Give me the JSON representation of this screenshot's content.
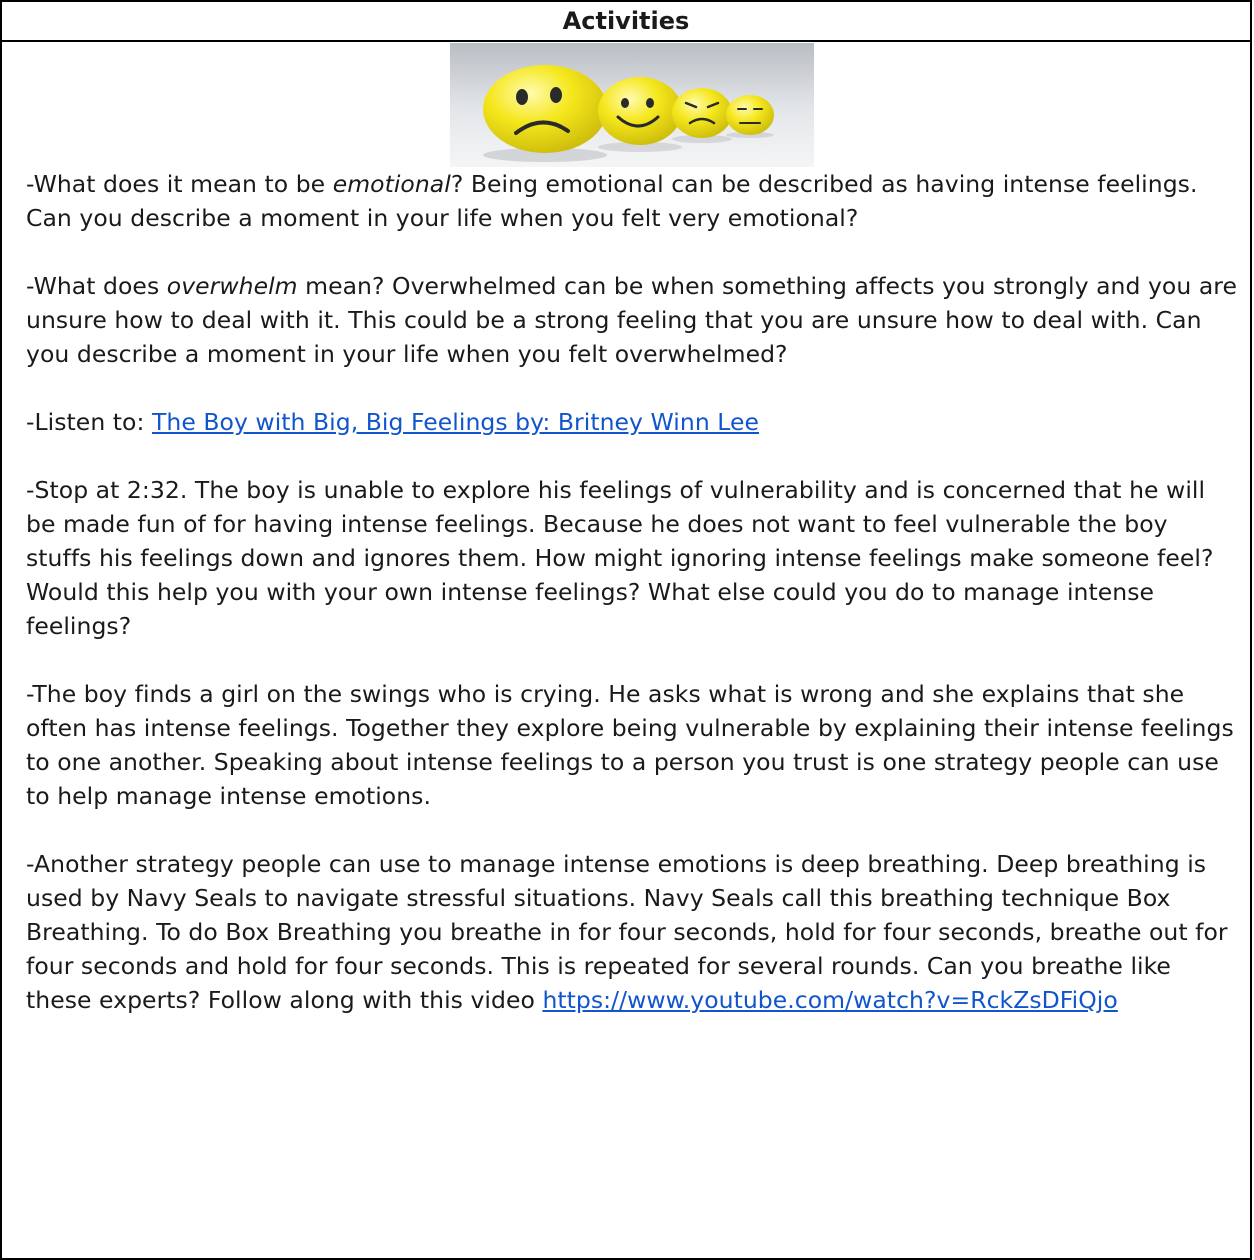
{
  "header": {
    "title": "Activities"
  },
  "image": {
    "description_icon": "emoji-balls-image"
  },
  "paragraphs": {
    "p1": {
      "pre": "-What does it mean to be ",
      "em": "emotional",
      "post": "? Being emotional can be described as having intense feelings. Can you describe a moment in your life when you felt very emotional?"
    },
    "p2": {
      "pre": "-What does ",
      "em": "overwhelm",
      "post": " mean? Overwhelmed can be when something affects you strongly and you are unsure how to deal with it. This could be a strong feeling that you are unsure how to deal with. Can you describe a moment in your life when you felt overwhelmed?"
    },
    "p3": {
      "pre": "-Listen to: ",
      "link": "The Boy with Big, Big Feelings by: Britney Winn Lee"
    },
    "p4": "-Stop at 2:32. The boy is unable to explore his feelings of vulnerability and is concerned that he will be made fun of for having intense feelings. Because he does not want to feel vulnerable the boy stuffs his feelings down and ignores them. How might ignoring intense feelings make someone feel? Would this help you with your own intense feelings? What else could you do to manage intense feelings?",
    "p5": "-The boy finds a girl on the swings who is crying. He asks what is wrong and she explains that she often has intense feelings. Together they explore being vulnerable by explaining their intense feelings to one another. Speaking about intense feelings to a person you trust is one strategy people can use to help manage intense emotions.",
    "p6": {
      "pre": "-Another strategy people can use to manage intense emotions is deep breathing. Deep breathing is used by Navy Seals to navigate stressful situations. Navy Seals call this breathing technique Box Breathing. To do Box Breathing you breathe in for four seconds, hold for four seconds, breathe out for four seconds and hold for four seconds. This is repeated for several rounds. Can you breathe like these experts? Follow along with this video ",
      "link": "https://www.youtube.com/watch?v=RckZsDFiQjo"
    }
  },
  "colors": {
    "link": "#1155cc",
    "ball_yellow": "#f2e21a",
    "border": "#000000"
  }
}
